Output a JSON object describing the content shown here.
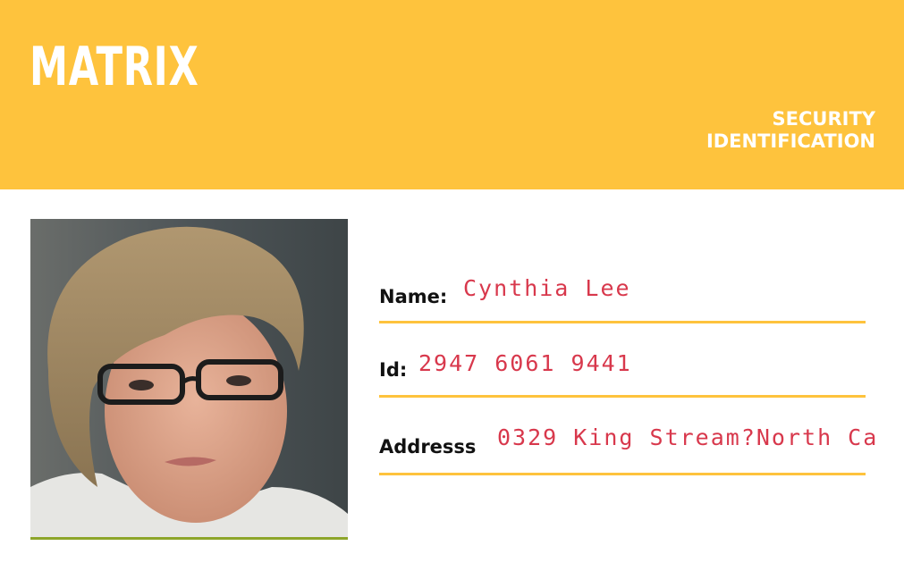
{
  "card": {
    "brand": "MATRIX",
    "card_type_line1": "SECURITY",
    "card_type_line2": "IDENTIFICATION",
    "colors": {
      "banner": "#fec33d",
      "value_text": "#d8384c",
      "rule": "#fec33d"
    }
  },
  "photo": {
    "icon": "portrait-photo"
  },
  "fields": {
    "name": {
      "label": "Name:",
      "value": "Cynthia Lee"
    },
    "id": {
      "label": "Id:",
      "value": "2947 6061 9441"
    },
    "address": {
      "label": "Addresss",
      "value": "0329 King Stream?North Ca"
    }
  }
}
